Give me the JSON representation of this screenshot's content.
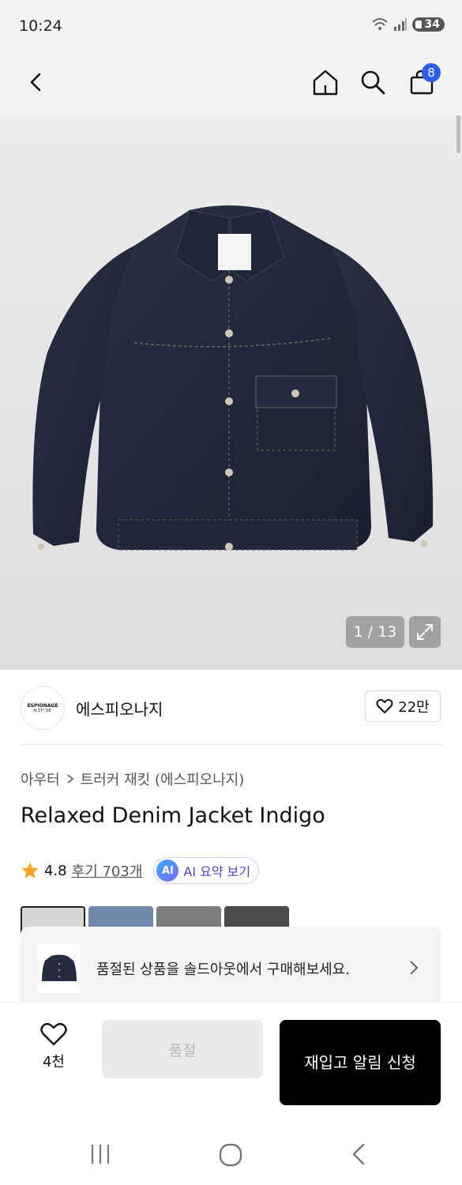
{
  "status_bar": {
    "time": "10:24",
    "battery": "34"
  },
  "header": {
    "cart_count": "8"
  },
  "gallery": {
    "counter": "1 / 13"
  },
  "brand": {
    "name": "에스피오나지",
    "logo_text": "ESPIONAGE",
    "logo_sub": "N 37° 56'",
    "likes": "22만"
  },
  "breadcrumb": [
    "아우터",
    "트러커 재킷 (에스피오나지)"
  ],
  "product": {
    "title": "Relaxed Denim Jacket Indigo",
    "rating": "4.8",
    "reviews": "후기 703개",
    "ai_icon": "AI",
    "ai_summary": "AI 요약 보기"
  },
  "soldout_banner": {
    "text": "품절된 상품을 솔드아웃에서 구매해보세요."
  },
  "bottom_bar": {
    "wish_count": "4천",
    "soldout_label": "품절",
    "restock_label": "재입고 알림 신청"
  },
  "colors": {
    "accent_blue": "#2f5bea",
    "star": "#f5a623",
    "ai_purple": "#5b3cc4"
  }
}
